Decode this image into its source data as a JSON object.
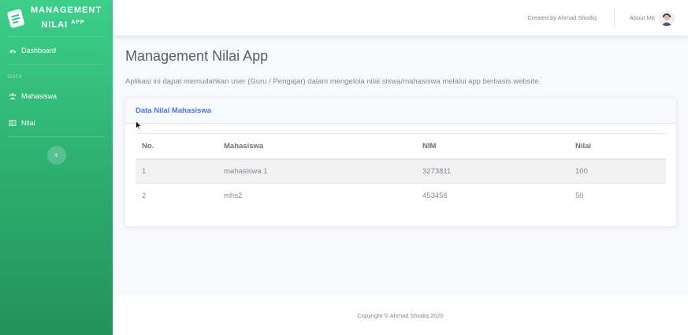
{
  "brand": {
    "line1": "MANAGEMENT",
    "line2": "NILAI",
    "sup": "APP",
    "icon": "clipboard-icon"
  },
  "sidebar": {
    "items": [
      {
        "label": "Dashboard",
        "icon": "dashboard-icon"
      }
    ],
    "heading": "DATA",
    "data_items": [
      {
        "label": "Mahasiswa",
        "icon": "users-icon"
      },
      {
        "label": "Nilai",
        "icon": "table-icon"
      }
    ],
    "toggle_glyph": "‹"
  },
  "topbar": {
    "credit": "Created by Ahmad Shodiq",
    "about": "About Me"
  },
  "page": {
    "title": "Management Nilai App",
    "description": "Aplikasi ini dapat memudahkan user (Guru / Pengajar) dalam mengelola nilai siswa/mahasiswa melalui app berbasis website."
  },
  "card": {
    "title": "Data Nilai Mahasiswa",
    "columns": [
      "No.",
      "Mahasiswa",
      "NIM",
      "Nilai"
    ],
    "rows": [
      [
        "1",
        "mahasiswa 1",
        "3273811",
        "100"
      ],
      [
        "2",
        "mhs2",
        "453456",
        "50"
      ]
    ]
  },
  "footer": {
    "copyright": "Copyright © Ahmad Shodiq 2020"
  },
  "colors": {
    "sidebar_top": "#3ccf8a",
    "sidebar_bottom": "#24915c",
    "accent": "#4e73df"
  }
}
